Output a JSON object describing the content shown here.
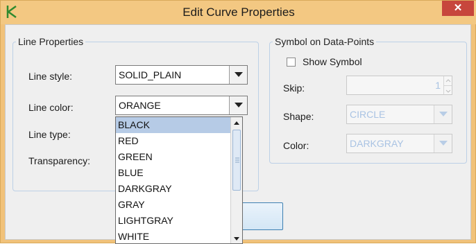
{
  "window": {
    "title": "Edit Curve Properties",
    "close_glyph": "✕"
  },
  "line_properties": {
    "legend": "Line Properties",
    "style_label": "Line style:",
    "style_value": "SOLID_PLAIN",
    "color_label": "Line color:",
    "color_value": "ORANGE",
    "type_label": "Line type:",
    "transparency_label": "Transparency:"
  },
  "color_dropdown": {
    "options": [
      "BLACK",
      "RED",
      "GREEN",
      "BLUE",
      "DARKGRAY",
      "GRAY",
      "LIGHTGRAY",
      "WHITE"
    ],
    "highlighted": "BLACK"
  },
  "symbol": {
    "legend": "Symbol on Data-Points",
    "show_label": "Show Symbol",
    "show_checked": false,
    "skip_label": "Skip:",
    "skip_value": "1",
    "shape_label": "Shape:",
    "shape_value": "CIRCLE",
    "color_label": "Color:",
    "color_value": "DARKGRAY"
  },
  "ok_button": {
    "label": "Ok",
    "visible_text": "k"
  },
  "colors": {
    "titlebar": "#f3c882",
    "close": "#c7463c",
    "selection": "#b6cbe6",
    "disabled_text": "#a9c3e3"
  },
  "icons": {
    "app": "chart-curve-icon",
    "dropdown": "chevron-down-icon"
  }
}
